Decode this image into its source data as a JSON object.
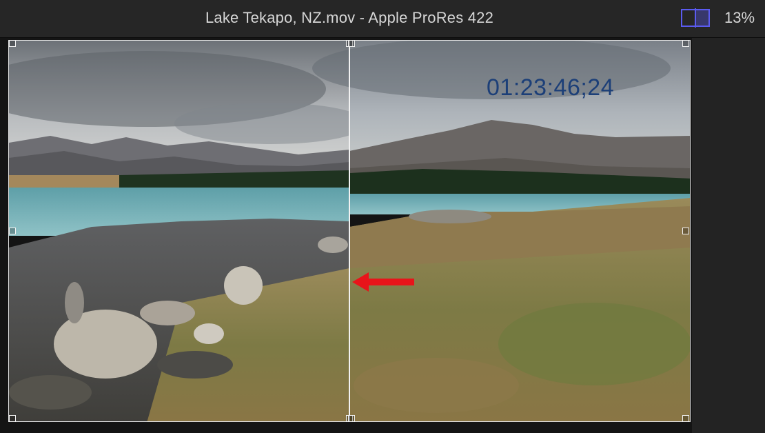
{
  "window": {
    "title": "Lake Tekapo, NZ.mov - Apple ProRes 422",
    "zoom": "13%"
  },
  "toolbar": {
    "compare_icon": "split-view-icon"
  },
  "viewer": {
    "timecode": "01:23:46;24",
    "divider_icon": "split-divider",
    "arrow_icon": "red-left-arrow-icon",
    "colors": {
      "timecode": "#1c3f78",
      "arrow": "#e8141a",
      "accent": "#5b5bf0"
    }
  }
}
